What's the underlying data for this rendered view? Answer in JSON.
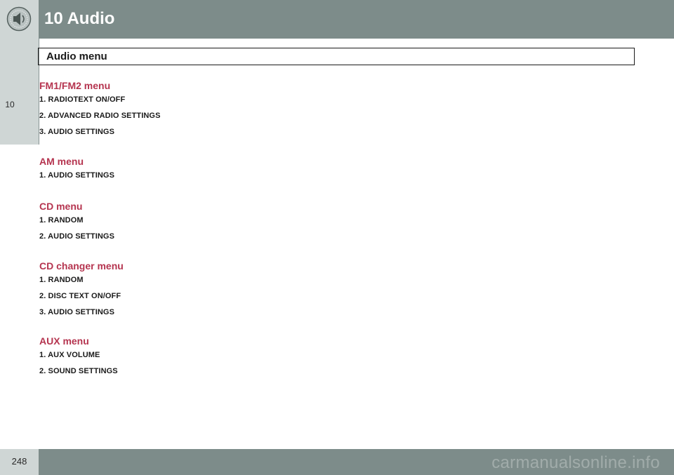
{
  "header": {
    "chapter_title": "10 Audio",
    "icon": "speaker-icon"
  },
  "side_tab": {
    "chapter_number": "10"
  },
  "section": {
    "title": "Audio menu"
  },
  "menus": [
    {
      "heading": "FM1/FM2 menu",
      "items": [
        "1. RADIOTEXT ON/OFF",
        "2. ADVANCED RADIO SETTINGS",
        "3. AUDIO SETTINGS"
      ]
    },
    {
      "heading": "AM menu",
      "items": [
        "1. AUDIO SETTINGS"
      ]
    },
    {
      "heading": "CD menu",
      "items": [
        "1. RANDOM",
        "2. AUDIO SETTINGS"
      ]
    },
    {
      "heading": "CD changer menu",
      "items": [
        "1. RANDOM",
        "2. DISC TEXT ON/OFF",
        "3. AUDIO SETTINGS"
      ]
    },
    {
      "heading": "AUX menu",
      "items": [
        "1. AUX VOLUME",
        "2. SOUND SETTINGS"
      ]
    }
  ],
  "footer": {
    "page_number": "248",
    "watermark": "carmanualsonline.info"
  },
  "colors": {
    "header_bar": "#7d8c8a",
    "tab_background": "#cfd6d5",
    "heading_accent": "#b5344f"
  }
}
